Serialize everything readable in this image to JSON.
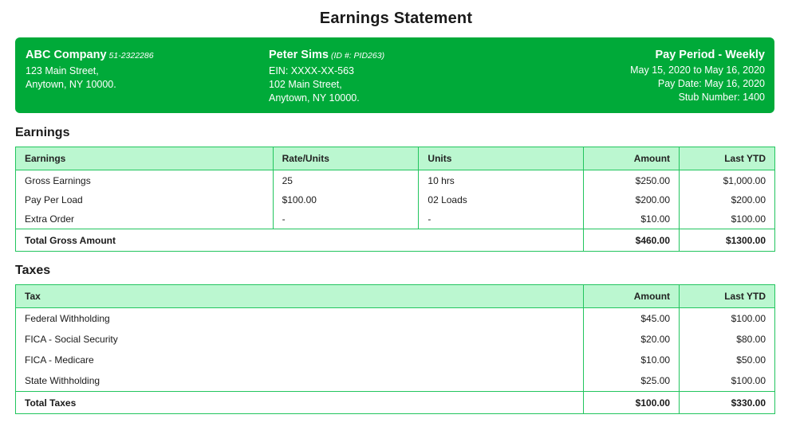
{
  "title": "Earnings Statement",
  "company": {
    "name": "ABC Company",
    "id": "51-2322286",
    "address_line1": "123 Main Street,",
    "address_line2": "Anytown, NY 10000."
  },
  "employee": {
    "name": "Peter Sims",
    "id": "(ID #: PID263)",
    "ein": "EIN: XXXX-XX-563",
    "address_line1": "102 Main Street,",
    "address_line2": "Anytown, NY 10000."
  },
  "pay_period": {
    "title": "Pay Period - Weekly",
    "range": "May 15, 2020 to May 16, 2020",
    "pay_date": "Pay Date: May 16, 2020",
    "stub": "Stub Number: 1400"
  },
  "earnings": {
    "section_title": "Earnings",
    "headers": [
      "Earnings",
      "Rate/Units",
      "Units",
      "Amount",
      "Last YTD"
    ],
    "rows": [
      [
        "Gross Earnings",
        "25",
        "10 hrs",
        "$250.00",
        "$1,000.00"
      ],
      [
        "Pay Per Load",
        "$100.00",
        "02 Loads",
        "$200.00",
        "$200.00"
      ],
      [
        "Extra Order",
        "-",
        "-",
        "$10.00",
        "$100.00"
      ]
    ],
    "total": {
      "label": "Total Gross Amount",
      "amount": "$460.00",
      "ytd": "$1300.00"
    }
  },
  "taxes": {
    "section_title": "Taxes",
    "headers": [
      "Tax",
      "Amount",
      "Last YTD"
    ],
    "rows": [
      [
        "Federal Withholding",
        "$45.00",
        "$100.00"
      ],
      [
        "FICA - Social Security",
        "$20.00",
        "$80.00"
      ],
      [
        "FICA - Medicare",
        "$10.00",
        "$50.00"
      ],
      [
        "State Withholding",
        "$25.00",
        "$100.00"
      ]
    ],
    "total": {
      "label": "Total Taxes",
      "amount": "$100.00",
      "ytd": "$330.00"
    }
  },
  "colors": {
    "header_green": "#00aa39",
    "table_header_bg": "#bbf7d0",
    "table_border": "#22c55e"
  }
}
